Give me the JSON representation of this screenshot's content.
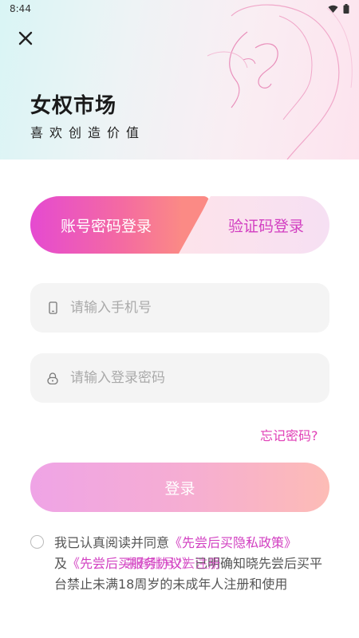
{
  "status_bar": {
    "time": "8:44",
    "icons": [
      "wifi-icon",
      "battery-icon"
    ]
  },
  "header": {
    "close_icon": "close-icon",
    "title": "女权市场",
    "subtitle": "喜欢创造价值",
    "decoration": "line-art-face"
  },
  "tabs": {
    "password_login": "账号密码登录",
    "code_login": "验证码登录",
    "active": "password_login"
  },
  "form": {
    "phone": {
      "placeholder": "请输入手机号",
      "value": "",
      "icon": "phone-icon"
    },
    "password": {
      "placeholder": "请输入登录密码",
      "value": "",
      "icon": "lock-icon"
    },
    "forgot_label": "忘记密码?",
    "login_label": "登录"
  },
  "agreement": {
    "prefix": "我已认真阅读并同意",
    "privacy_link": "《先尝后买隐私政策》",
    "and": "及",
    "service_link": "《先尝后买服务协议》",
    "suffix": "已明确知晓先尝后买平台禁止未满18周岁的未成年人注册和使用",
    "overlay_text": "未有账号?去注册",
    "checked": false
  },
  "colors": {
    "accent": "#e03fb6",
    "tab_gradient_start": "#e54ad1",
    "tab_gradient_end": "#fb8a85",
    "button_gradient_start": "#efa4e6",
    "button_gradient_end": "#fdbcb6",
    "input_bg": "#f4f4f4"
  }
}
